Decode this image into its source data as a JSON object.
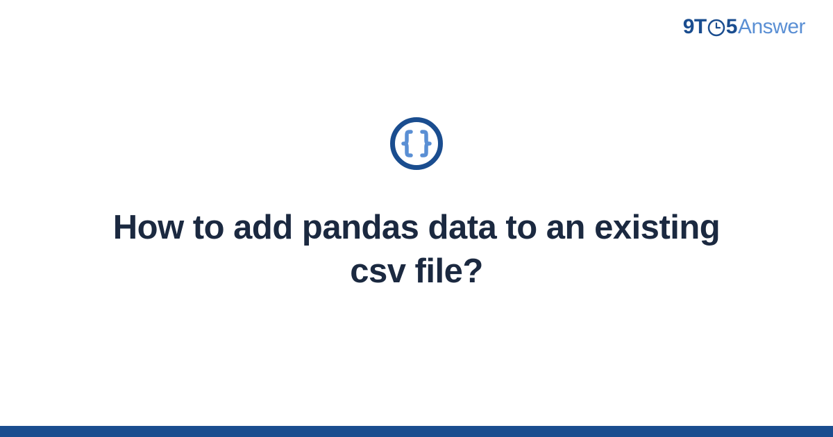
{
  "header": {
    "logo": {
      "part1": "9T",
      "part2": "5",
      "part3": "Answer"
    }
  },
  "main": {
    "icon_name": "code-braces-icon",
    "title": "How to add pandas data to an existing csv file?"
  },
  "colors": {
    "brand_dark": "#1a4d8f",
    "brand_light": "#5a8fd4",
    "title_text": "#1b2940",
    "icon_inner": "#5a8fd4",
    "icon_ring": "#1a4d8f",
    "bottom_bar": "#1a4d8f"
  }
}
